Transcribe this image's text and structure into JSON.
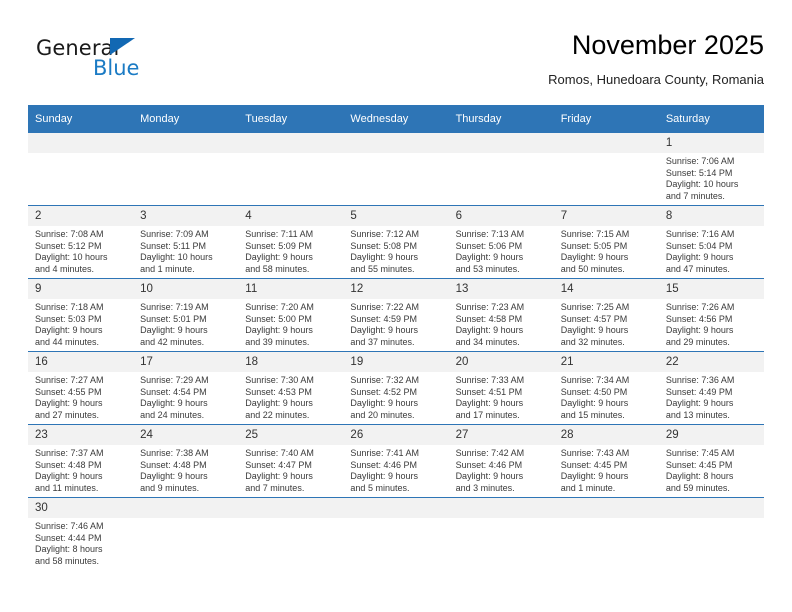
{
  "brand": {
    "name_top": "General",
    "name_bottom": "Blue",
    "triangle_color": "#1268b3",
    "blue_color": "#1b7bc4"
  },
  "header": {
    "title": "November 2025",
    "subtitle": "Romos, Hunedoara County, Romania"
  },
  "theme": {
    "header_blue": "#2E75B6",
    "daynum_band": "#F2F2F2",
    "row_divider": "#2E75B6"
  },
  "weekdays": [
    "Sunday",
    "Monday",
    "Tuesday",
    "Wednesday",
    "Thursday",
    "Friday",
    "Saturday"
  ],
  "labels": {
    "sunrise_prefix": "Sunrise: ",
    "sunset_prefix": "Sunset: ",
    "daylight_prefix": "Daylight: "
  },
  "weeks": [
    [
      {
        "day": "",
        "empty": true
      },
      {
        "day": "",
        "empty": true
      },
      {
        "day": "",
        "empty": true
      },
      {
        "day": "",
        "empty": true
      },
      {
        "day": "",
        "empty": true
      },
      {
        "day": "",
        "empty": true
      },
      {
        "day": "1",
        "sunrise": "Sunrise: 7:06 AM",
        "sunset": "Sunset: 5:14 PM",
        "daylight1": "Daylight: 10 hours",
        "daylight2": "and 7 minutes."
      }
    ],
    [
      {
        "day": "2",
        "sunrise": "Sunrise: 7:08 AM",
        "sunset": "Sunset: 5:12 PM",
        "daylight1": "Daylight: 10 hours",
        "daylight2": "and 4 minutes."
      },
      {
        "day": "3",
        "sunrise": "Sunrise: 7:09 AM",
        "sunset": "Sunset: 5:11 PM",
        "daylight1": "Daylight: 10 hours",
        "daylight2": "and 1 minute."
      },
      {
        "day": "4",
        "sunrise": "Sunrise: 7:11 AM",
        "sunset": "Sunset: 5:09 PM",
        "daylight1": "Daylight: 9 hours",
        "daylight2": "and 58 minutes."
      },
      {
        "day": "5",
        "sunrise": "Sunrise: 7:12 AM",
        "sunset": "Sunset: 5:08 PM",
        "daylight1": "Daylight: 9 hours",
        "daylight2": "and 55 minutes."
      },
      {
        "day": "6",
        "sunrise": "Sunrise: 7:13 AM",
        "sunset": "Sunset: 5:06 PM",
        "daylight1": "Daylight: 9 hours",
        "daylight2": "and 53 minutes."
      },
      {
        "day": "7",
        "sunrise": "Sunrise: 7:15 AM",
        "sunset": "Sunset: 5:05 PM",
        "daylight1": "Daylight: 9 hours",
        "daylight2": "and 50 minutes."
      },
      {
        "day": "8",
        "sunrise": "Sunrise: 7:16 AM",
        "sunset": "Sunset: 5:04 PM",
        "daylight1": "Daylight: 9 hours",
        "daylight2": "and 47 minutes."
      }
    ],
    [
      {
        "day": "9",
        "sunrise": "Sunrise: 7:18 AM",
        "sunset": "Sunset: 5:03 PM",
        "daylight1": "Daylight: 9 hours",
        "daylight2": "and 44 minutes."
      },
      {
        "day": "10",
        "sunrise": "Sunrise: 7:19 AM",
        "sunset": "Sunset: 5:01 PM",
        "daylight1": "Daylight: 9 hours",
        "daylight2": "and 42 minutes."
      },
      {
        "day": "11",
        "sunrise": "Sunrise: 7:20 AM",
        "sunset": "Sunset: 5:00 PM",
        "daylight1": "Daylight: 9 hours",
        "daylight2": "and 39 minutes."
      },
      {
        "day": "12",
        "sunrise": "Sunrise: 7:22 AM",
        "sunset": "Sunset: 4:59 PM",
        "daylight1": "Daylight: 9 hours",
        "daylight2": "and 37 minutes."
      },
      {
        "day": "13",
        "sunrise": "Sunrise: 7:23 AM",
        "sunset": "Sunset: 4:58 PM",
        "daylight1": "Daylight: 9 hours",
        "daylight2": "and 34 minutes."
      },
      {
        "day": "14",
        "sunrise": "Sunrise: 7:25 AM",
        "sunset": "Sunset: 4:57 PM",
        "daylight1": "Daylight: 9 hours",
        "daylight2": "and 32 minutes."
      },
      {
        "day": "15",
        "sunrise": "Sunrise: 7:26 AM",
        "sunset": "Sunset: 4:56 PM",
        "daylight1": "Daylight: 9 hours",
        "daylight2": "and 29 minutes."
      }
    ],
    [
      {
        "day": "16",
        "sunrise": "Sunrise: 7:27 AM",
        "sunset": "Sunset: 4:55 PM",
        "daylight1": "Daylight: 9 hours",
        "daylight2": "and 27 minutes."
      },
      {
        "day": "17",
        "sunrise": "Sunrise: 7:29 AM",
        "sunset": "Sunset: 4:54 PM",
        "daylight1": "Daylight: 9 hours",
        "daylight2": "and 24 minutes."
      },
      {
        "day": "18",
        "sunrise": "Sunrise: 7:30 AM",
        "sunset": "Sunset: 4:53 PM",
        "daylight1": "Daylight: 9 hours",
        "daylight2": "and 22 minutes."
      },
      {
        "day": "19",
        "sunrise": "Sunrise: 7:32 AM",
        "sunset": "Sunset: 4:52 PM",
        "daylight1": "Daylight: 9 hours",
        "daylight2": "and 20 minutes."
      },
      {
        "day": "20",
        "sunrise": "Sunrise: 7:33 AM",
        "sunset": "Sunset: 4:51 PM",
        "daylight1": "Daylight: 9 hours",
        "daylight2": "and 17 minutes."
      },
      {
        "day": "21",
        "sunrise": "Sunrise: 7:34 AM",
        "sunset": "Sunset: 4:50 PM",
        "daylight1": "Daylight: 9 hours",
        "daylight2": "and 15 minutes."
      },
      {
        "day": "22",
        "sunrise": "Sunrise: 7:36 AM",
        "sunset": "Sunset: 4:49 PM",
        "daylight1": "Daylight: 9 hours",
        "daylight2": "and 13 minutes."
      }
    ],
    [
      {
        "day": "23",
        "sunrise": "Sunrise: 7:37 AM",
        "sunset": "Sunset: 4:48 PM",
        "daylight1": "Daylight: 9 hours",
        "daylight2": "and 11 minutes."
      },
      {
        "day": "24",
        "sunrise": "Sunrise: 7:38 AM",
        "sunset": "Sunset: 4:48 PM",
        "daylight1": "Daylight: 9 hours",
        "daylight2": "and 9 minutes."
      },
      {
        "day": "25",
        "sunrise": "Sunrise: 7:40 AM",
        "sunset": "Sunset: 4:47 PM",
        "daylight1": "Daylight: 9 hours",
        "daylight2": "and 7 minutes."
      },
      {
        "day": "26",
        "sunrise": "Sunrise: 7:41 AM",
        "sunset": "Sunset: 4:46 PM",
        "daylight1": "Daylight: 9 hours",
        "daylight2": "and 5 minutes."
      },
      {
        "day": "27",
        "sunrise": "Sunrise: 7:42 AM",
        "sunset": "Sunset: 4:46 PM",
        "daylight1": "Daylight: 9 hours",
        "daylight2": "and 3 minutes."
      },
      {
        "day": "28",
        "sunrise": "Sunrise: 7:43 AM",
        "sunset": "Sunset: 4:45 PM",
        "daylight1": "Daylight: 9 hours",
        "daylight2": "and 1 minute."
      },
      {
        "day": "29",
        "sunrise": "Sunrise: 7:45 AM",
        "sunset": "Sunset: 4:45 PM",
        "daylight1": "Daylight: 8 hours",
        "daylight2": "and 59 minutes."
      }
    ],
    [
      {
        "day": "30",
        "sunrise": "Sunrise: 7:46 AM",
        "sunset": "Sunset: 4:44 PM",
        "daylight1": "Daylight: 8 hours",
        "daylight2": "and 58 minutes."
      },
      {
        "day": "",
        "empty": true
      },
      {
        "day": "",
        "empty": true
      },
      {
        "day": "",
        "empty": true
      },
      {
        "day": "",
        "empty": true
      },
      {
        "day": "",
        "empty": true
      },
      {
        "day": "",
        "empty": true
      }
    ]
  ]
}
